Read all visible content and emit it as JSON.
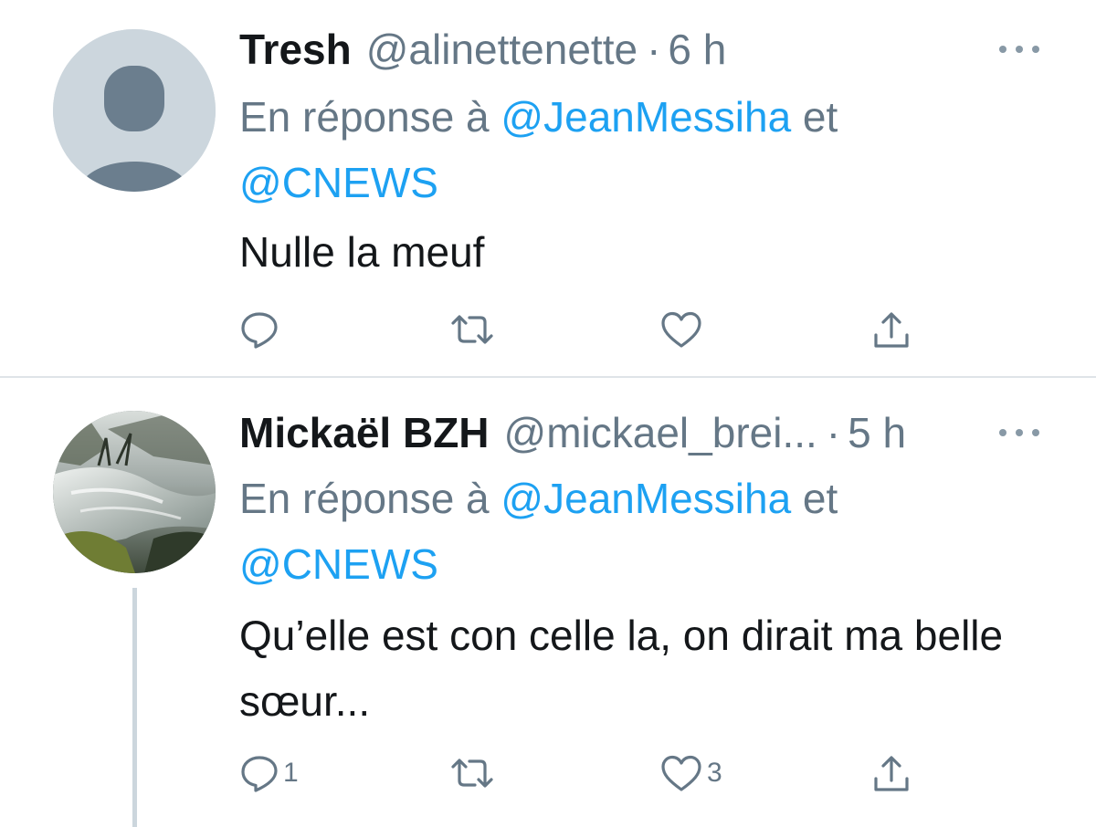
{
  "tweets": [
    {
      "display_name": "Tresh",
      "handle": "@alinettenette",
      "time": "6 h",
      "reply_prefix": "En réponse à ",
      "mention_1": "@JeanMessiha",
      "reply_joiner": " et ",
      "mention_2": "@CNEWS",
      "text": "Nulle la meuf",
      "reply_count": "",
      "like_count": "",
      "avatar": "default-avatar"
    },
    {
      "display_name": "Mickaël BZH",
      "handle": "@mickael_brei...",
      "time": "5 h",
      "reply_prefix": "En réponse à ",
      "mention_1": "@JeanMessiha",
      "reply_joiner": " et ",
      "mention_2": "@CNEWS",
      "text": "Qu’elle est con celle la, on dirait ma belle sœur...",
      "reply_count": "1",
      "like_count": "3",
      "avatar": "landscape-photo-avatar"
    }
  ],
  "separator": "·",
  "icons": {
    "reply": "reply-icon",
    "retweet": "retweet-icon",
    "like": "heart-icon",
    "share": "share-icon",
    "more": "more-icon"
  },
  "colors": {
    "link": "#1da1f2",
    "secondary_text": "#657786",
    "primary_text": "#14171a",
    "divider": "#dfe4e8"
  }
}
